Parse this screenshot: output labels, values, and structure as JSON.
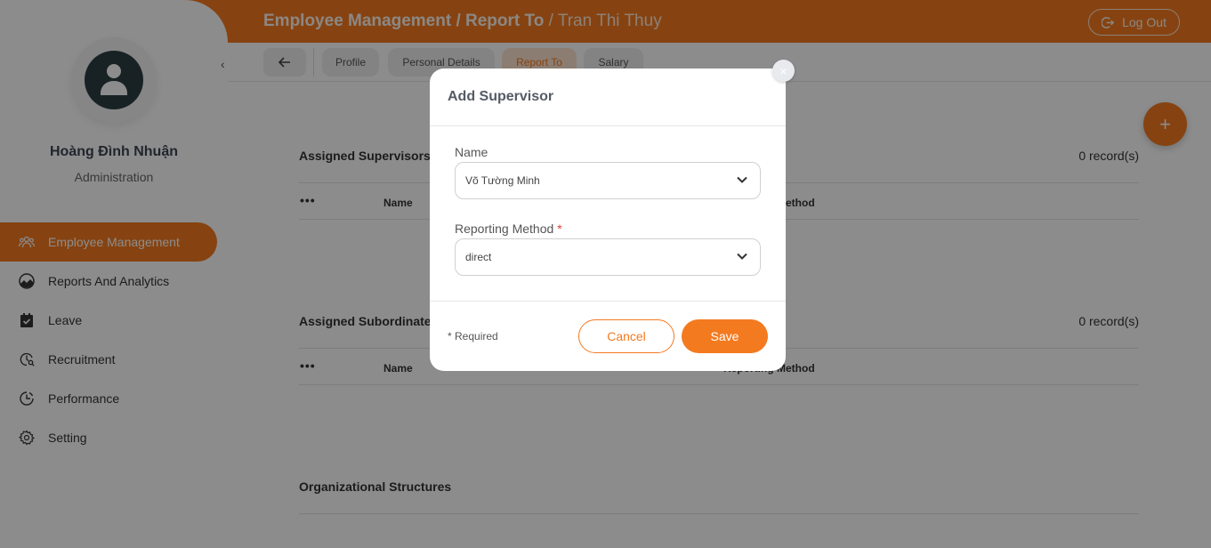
{
  "header": {
    "breadcrumb_section": "Employee Management",
    "breadcrumb_sep1": " / ",
    "breadcrumb_page": "Report To",
    "breadcrumb_sep2": " / ",
    "breadcrumb_employee": "Tran Thi Thuy",
    "logout_label": "Log Out"
  },
  "sidebar": {
    "user_name": "Hoàng Đình Nhuận",
    "user_role": "Administration",
    "collapse_icon": "‹",
    "items": [
      {
        "label": "Employee Management",
        "icon": "people-icon",
        "active": true
      },
      {
        "label": "Reports And Analytics",
        "icon": "chart-icon"
      },
      {
        "label": "Leave",
        "icon": "calendar-check-icon"
      },
      {
        "label": "Recruitment",
        "icon": "recruitment-icon"
      },
      {
        "label": "Performance",
        "icon": "clock-icon"
      },
      {
        "label": "Setting",
        "icon": "gear-icon"
      }
    ]
  },
  "tabs": [
    {
      "label": "Profile"
    },
    {
      "label": "Personal Details"
    },
    {
      "label": "Report To",
      "active": true
    },
    {
      "label": "Salary"
    }
  ],
  "content": {
    "fab_label": "+",
    "supervisors": {
      "title": "Assigned Supervisors",
      "count": "0 record(s)",
      "col_actions": "•••",
      "col_name": "Name",
      "col_method": "Reporting Method"
    },
    "subordinates": {
      "title": "Assigned Subordinates",
      "count": "0 record(s)",
      "col_actions": "•••",
      "col_name": "Name",
      "col_method": "Reporting Method"
    },
    "org_title": "Organizational Structures"
  },
  "modal": {
    "title": "Add Supervisor",
    "close_label": "×",
    "name_label": "Name",
    "name_value": "Võ Tường Minh",
    "method_label": "Reporting Method",
    "required_star": "*",
    "method_value": "direct",
    "required_note": "* Required",
    "cancel_label": "Cancel",
    "save_label": "Save"
  },
  "colors": {
    "accent": "#f47a20",
    "accent_light": "#fde3cf"
  }
}
